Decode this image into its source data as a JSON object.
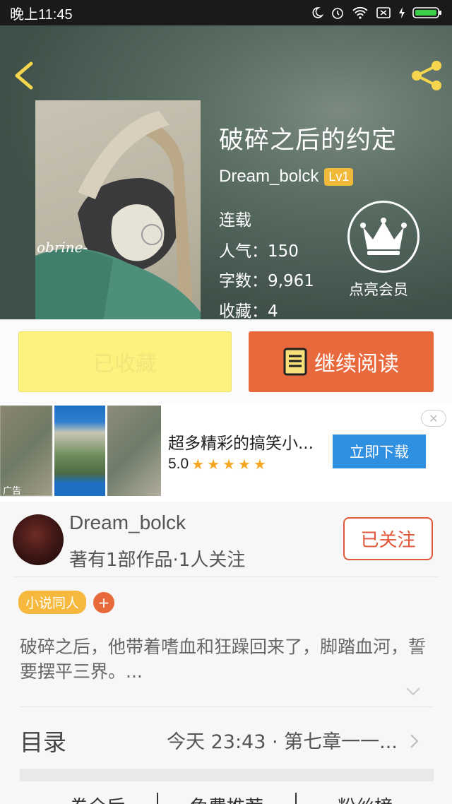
{
  "status_bar": {
    "time": "晚上11:45"
  },
  "book": {
    "title": "破碎之后的约定",
    "author": "Dream_bolck",
    "level": "Lv1",
    "status": "连载",
    "popularity": "人气：150",
    "word_count": "字数：9,961",
    "favorites": "收藏：4",
    "cover_watermark": "obrine-"
  },
  "vip": {
    "label": "点亮会员"
  },
  "actions": {
    "favorited_label": "已收藏",
    "continue_label": "继续阅读"
  },
  "ad": {
    "title": "超多精彩的搞笑小...",
    "rating": "5.0",
    "stars": 5,
    "download_label": "立即下载",
    "tag": "广告",
    "close_glyph": "✕"
  },
  "author_section": {
    "name": "Dream_bolck",
    "stats": "著有1部作品·1人关注",
    "follow_label": "已关注",
    "tag": "小说同人",
    "tag_add": "+"
  },
  "description": "破碎之后，他带着嗜血和狂躁回来了，脚踏血河，誓要摆平三界。...",
  "toc": {
    "label": "目录",
    "latest": "今天 23:43 · 第七章一一..."
  },
  "bottom_tabs": [
    "一卷全后",
    "免费推荐",
    "粉丝榜"
  ],
  "colors": {
    "accent_orange": "#e8693b",
    "fav_yellow": "#fbf37e",
    "badge_gold": "#f0b93a",
    "ad_blue": "#2f8fe0"
  }
}
